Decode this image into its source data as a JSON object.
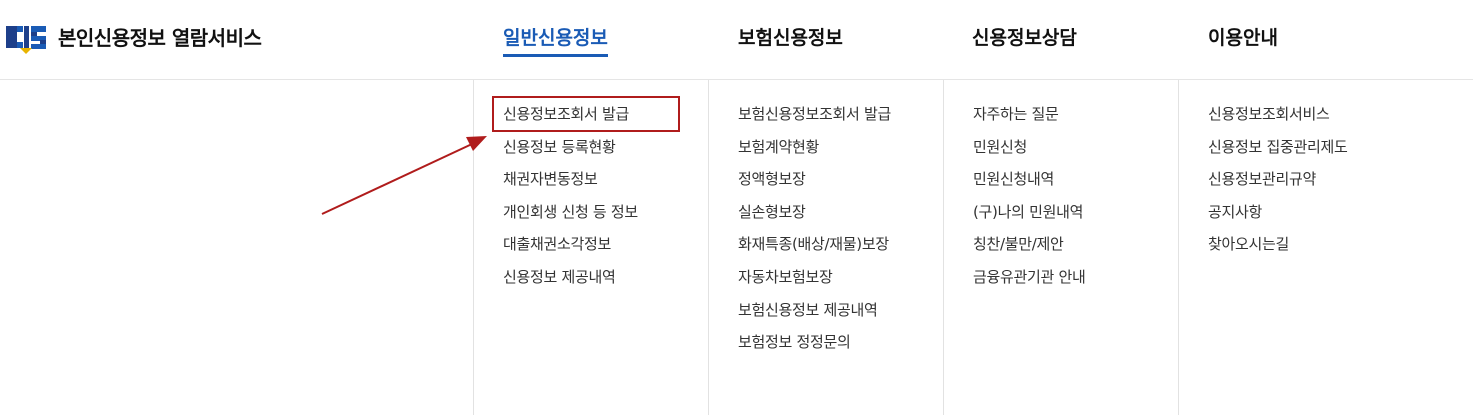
{
  "site": {
    "title": "본인신용정보 열람서비스",
    "logo_icon": "cis-logo-icon",
    "brand_colors": {
      "blue": "#1a5bb5",
      "navy": "#1d3f8a",
      "yellow": "#e8b400",
      "red_highlight": "#b01c1c"
    }
  },
  "gnb": [
    {
      "label": "일반신용정보",
      "active": true
    },
    {
      "label": "보험신용정보",
      "active": false
    },
    {
      "label": "신용정보상담",
      "active": false
    },
    {
      "label": "이용안내",
      "active": false
    }
  ],
  "submenus": [
    {
      "items": [
        "신용정보조회서 발급",
        "신용정보 등록현황",
        "채권자변동정보",
        "개인회생 신청 등 정보",
        "대출채권소각정보",
        "신용정보 제공내역"
      ]
    },
    {
      "items": [
        "보험신용정보조회서 발급",
        "보험계약현황",
        "정액형보장",
        "실손형보장",
        "화재특종(배상/재물)보장",
        "자동차보험보장",
        "보험신용정보 제공내역",
        "보험정보 정정문의"
      ]
    },
    {
      "items": [
        "자주하는 질문",
        "민원신청",
        "민원신청내역",
        "(구)나의 민원내역",
        "칭찬/불만/제안",
        "금융유관기관 안내"
      ]
    },
    {
      "items": [
        "신용정보조회서비스",
        "신용정보 집중관리제도",
        "신용정보관리규약",
        "공지사항",
        "찾아오시는길"
      ]
    }
  ],
  "annotation": {
    "highlighted_item": "신용정보조회서 발급"
  }
}
